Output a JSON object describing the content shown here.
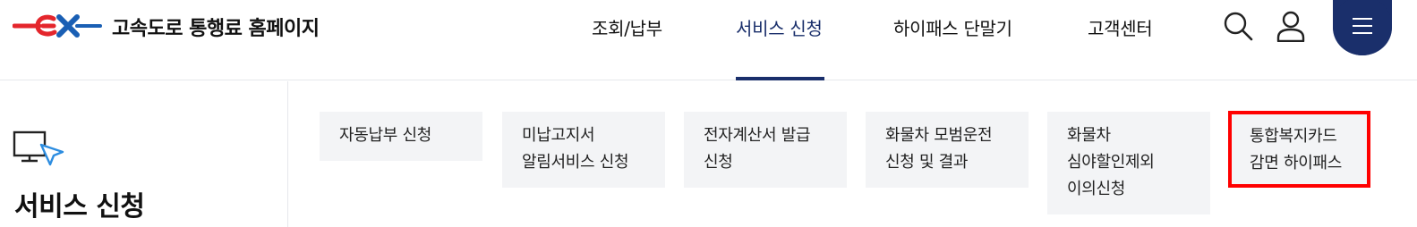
{
  "header": {
    "site_title": "고속도로 통행료 홈페이지",
    "nav": [
      {
        "label": "조회/납부"
      },
      {
        "label": "서비스 신청"
      },
      {
        "label": "하이패스 단말기"
      },
      {
        "label": "고객센터"
      }
    ],
    "active_nav": "서비스 신청",
    "icons": [
      "search-icon",
      "user-icon",
      "hamburger-menu-icon"
    ],
    "brand_color": "#1a2f6b",
    "logo_color": "#e4262c"
  },
  "sidebar": {
    "title": "서비스 신청",
    "icon": "monitor-cursor-icon"
  },
  "cards": [
    {
      "lines": [
        "자동납부 신청"
      ]
    },
    {
      "lines": [
        "미납고지서",
        "알림서비스 신청"
      ]
    },
    {
      "lines": [
        "전자계산서 발급",
        "신청"
      ]
    },
    {
      "lines": [
        "화물차 모범운전",
        "신청 및 결과"
      ]
    },
    {
      "lines": [
        "화물차",
        "심야할인제외",
        "이의신청"
      ]
    },
    {
      "lines": [
        "통합복지카드",
        "감면 하이패스"
      ]
    }
  ],
  "highlight_color": "#ff0000"
}
